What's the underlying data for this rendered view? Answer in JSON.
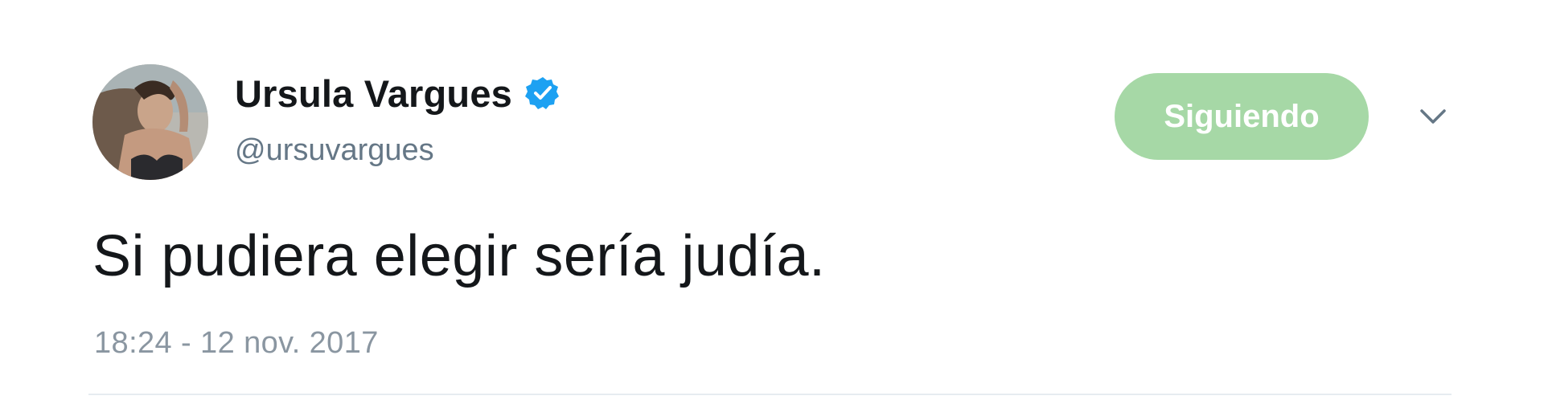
{
  "tweet": {
    "author": {
      "display_name": "Ursula Vargues",
      "handle": "@ursuvargues",
      "verified_icon": "verified-badge-icon",
      "avatar": "profile-photo"
    },
    "follow_button_label": "Siguiendo",
    "menu_icon": "chevron-down-icon",
    "text": "Si pudiera elegir sería judía.",
    "timestamp": "18:24 - 12 nov. 2017"
  },
  "colors": {
    "name": "#14171a",
    "handle": "#657786",
    "verified": "#1da1f2",
    "follow_button_bg": "#a6d8a6",
    "timestamp": "#8a96a1"
  }
}
